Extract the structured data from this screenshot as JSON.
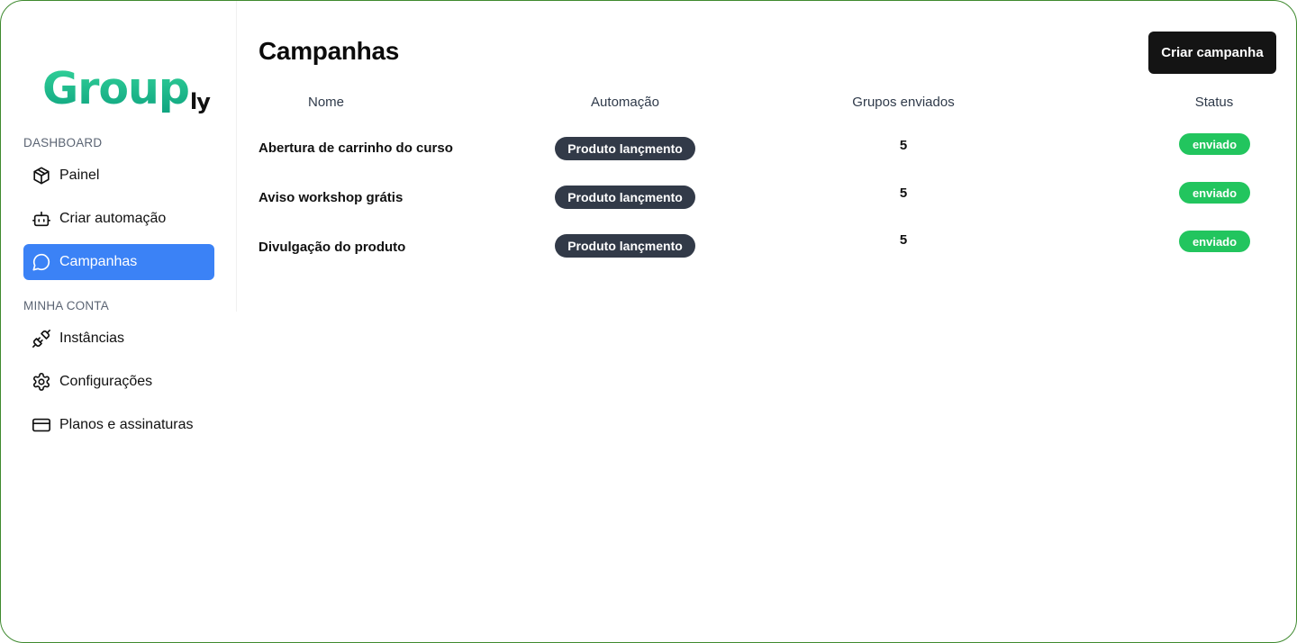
{
  "brand": {
    "name_main": "Group",
    "name_suffix": "ly"
  },
  "sidebar": {
    "sections": [
      {
        "label": "DASHBOARD",
        "items": [
          {
            "label": "Painel",
            "icon": "package-icon",
            "active": false
          },
          {
            "label": "Criar automação",
            "icon": "bot-icon",
            "active": false
          },
          {
            "label": "Campanhas",
            "icon": "message-circle-icon",
            "active": true
          }
        ]
      },
      {
        "label": "MINHA CONTA",
        "items": [
          {
            "label": "Instâncias",
            "icon": "plug-icon",
            "active": false
          },
          {
            "label": "Configurações",
            "icon": "gear-icon",
            "active": false
          },
          {
            "label": "Planos e assinaturas",
            "icon": "credit-card-icon",
            "active": false
          }
        ]
      }
    ]
  },
  "main": {
    "title": "Campanhas",
    "create_button_label": "Criar campanha",
    "table": {
      "headers": [
        "Nome",
        "Automação",
        "Grupos enviados",
        "Status"
      ],
      "rows": [
        {
          "name": "Abertura de carrinho do curso",
          "automation": "Produto lançmento",
          "groups_sent": "5",
          "status": "enviado"
        },
        {
          "name": "Aviso workshop grátis",
          "automation": "Produto lançmento",
          "groups_sent": "5",
          "status": "enviado"
        },
        {
          "name": "Divulgação do produto",
          "automation": "Produto lançmento",
          "groups_sent": "5",
          "status": "enviado"
        }
      ]
    }
  },
  "colors": {
    "accent": "#3b82f6",
    "status_success": "#22c55e",
    "automation_pill": "#323a48",
    "primary_button": "#141414",
    "logo_gradient_top": "#34d39a",
    "logo_gradient_bottom": "#0ea37f",
    "frame_border": "#3f8a2f"
  }
}
